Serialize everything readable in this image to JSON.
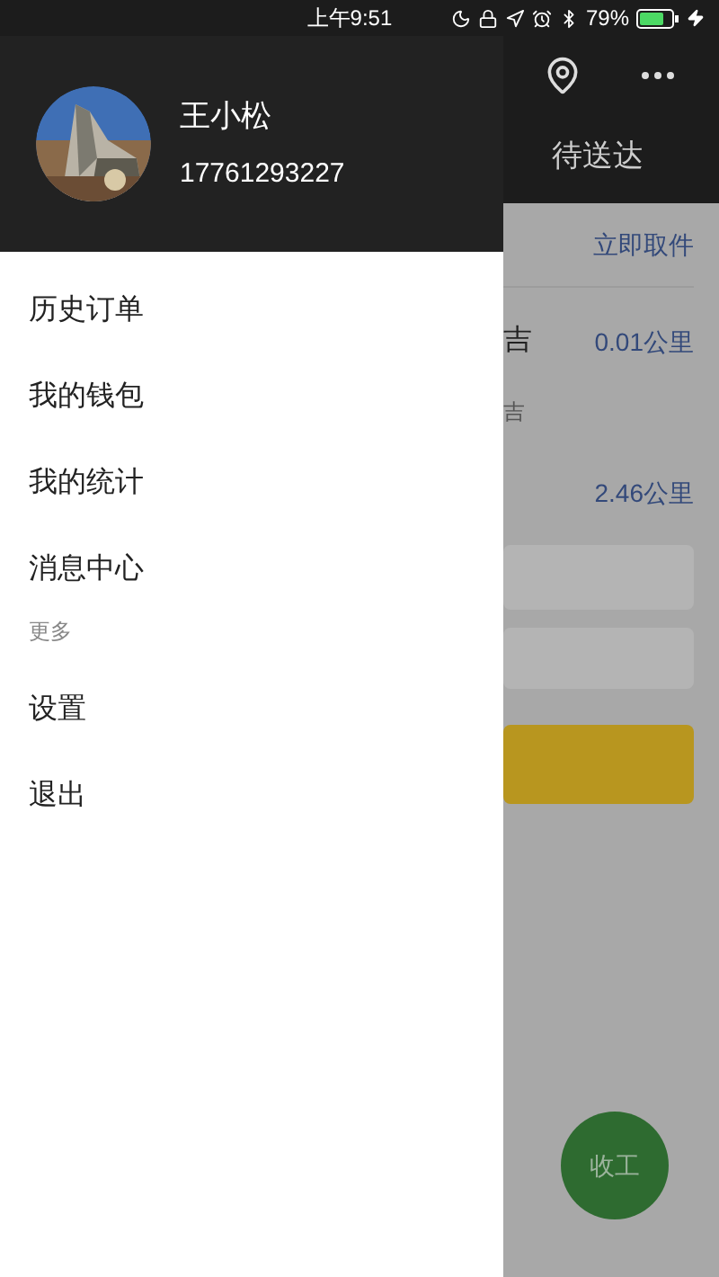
{
  "status_bar": {
    "time": "上午9:51",
    "battery": "79%"
  },
  "drawer": {
    "user": {
      "name": "王小松",
      "phone": "17761293227"
    },
    "menu": [
      {
        "kind": "item",
        "label": "历史订单"
      },
      {
        "kind": "item",
        "label": "我的钱包"
      },
      {
        "kind": "item",
        "label": "我的统计"
      },
      {
        "kind": "item",
        "label": "消息中心"
      },
      {
        "kind": "section",
        "label": "更多"
      },
      {
        "kind": "item",
        "label": "设置"
      },
      {
        "kind": "item",
        "label": "退出"
      }
    ]
  },
  "background_page": {
    "tab": "待送达",
    "action": "立即取件",
    "row_text": "吉",
    "row_distance": "0.01公里",
    "sub_text": "吉",
    "distance_2": "2.46公里",
    "fab": "收工"
  }
}
